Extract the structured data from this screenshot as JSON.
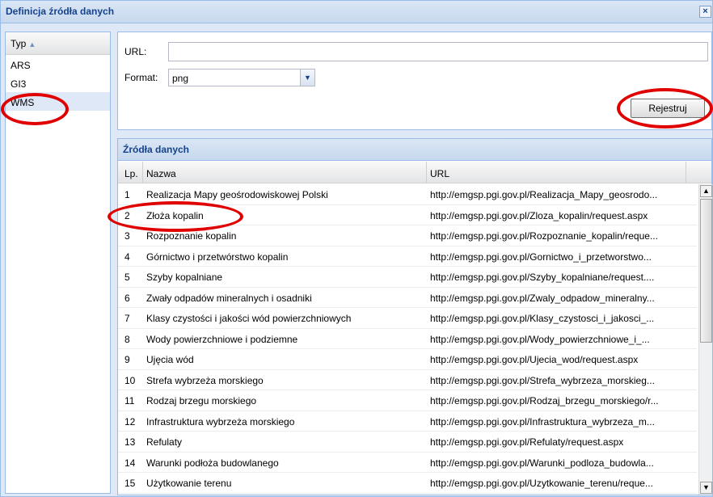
{
  "window": {
    "title": "Definicja źródła danych",
    "close_glyph": "×"
  },
  "type_panel": {
    "header": "Typ",
    "sort_glyph": "▲",
    "items": [
      {
        "label": "ARS"
      },
      {
        "label": "GI3"
      },
      {
        "label": "WMS",
        "selected": true
      }
    ]
  },
  "form": {
    "url_label": "URL:",
    "url_value": "",
    "format_label": "Format:",
    "format_value": "png",
    "submit_label": "Rejestruj"
  },
  "grid": {
    "title": "Źródła danych",
    "columns": [
      "Lp.",
      "Nazwa",
      "URL"
    ],
    "rows": [
      {
        "lp": "1",
        "nazwa": "Realizacja Mapy geośrodowiskowej Polski",
        "url": "http://emgsp.pgi.gov.pl/Realizacja_Mapy_geosrodo..."
      },
      {
        "lp": "2",
        "nazwa": "Złoża kopalin",
        "url": "http://emgsp.pgi.gov.pl/Zloza_kopalin/request.aspx"
      },
      {
        "lp": "3",
        "nazwa": "Rozpoznanie kopalin",
        "url": "http://emgsp.pgi.gov.pl/Rozpoznanie_kopalin/reque..."
      },
      {
        "lp": "4",
        "nazwa": "Górnictwo i przetwórstwo kopalin",
        "url": "http://emgsp.pgi.gov.pl/Gornictwo_i_przetworstwo..."
      },
      {
        "lp": "5",
        "nazwa": "Szyby kopalniane",
        "url": "http://emgsp.pgi.gov.pl/Szyby_kopalniane/request...."
      },
      {
        "lp": "6",
        "nazwa": "Zwały odpadów mineralnych i osadniki",
        "url": "http://emgsp.pgi.gov.pl/Zwaly_odpadow_mineralny..."
      },
      {
        "lp": "7",
        "nazwa": "Klasy czystości i jakości wód powierzchniowych",
        "url": "http://emgsp.pgi.gov.pl/Klasy_czystosci_i_jakosci_..."
      },
      {
        "lp": "8",
        "nazwa": "Wody powierzchniowe i podziemne",
        "url": "http://emgsp.pgi.gov.pl/Wody_powierzchniowe_i_..."
      },
      {
        "lp": "9",
        "nazwa": "Ujęcia wód",
        "url": "http://emgsp.pgi.gov.pl/Ujecia_wod/request.aspx"
      },
      {
        "lp": "10",
        "nazwa": "Strefa wybrzeża morskiego",
        "url": "http://emgsp.pgi.gov.pl/Strefa_wybrzeza_morskieg..."
      },
      {
        "lp": "11",
        "nazwa": "Rodzaj brzegu morskiego",
        "url": "http://emgsp.pgi.gov.pl/Rodzaj_brzegu_morskiego/r..."
      },
      {
        "lp": "12",
        "nazwa": "Infrastruktura wybrzeża morskiego",
        "url": "http://emgsp.pgi.gov.pl/Infrastruktura_wybrzeza_m..."
      },
      {
        "lp": "13",
        "nazwa": "Refulaty",
        "url": "http://emgsp.pgi.gov.pl/Refulaty/request.aspx"
      },
      {
        "lp": "14",
        "nazwa": "Warunki podłoża budowlanego",
        "url": "http://emgsp.pgi.gov.pl/Warunki_podloza_budowla..."
      },
      {
        "lp": "15",
        "nazwa": "Użytkowanie terenu",
        "url": "http://emgsp.pgi.gov.pl/Uzytkowanie_terenu/reque..."
      }
    ]
  },
  "scrollbar": {
    "up_glyph": "▲",
    "down_glyph": "▼"
  },
  "colors": {
    "accent": "#15428b",
    "panel_border": "#99bbe8",
    "annotation": "#e00000"
  }
}
